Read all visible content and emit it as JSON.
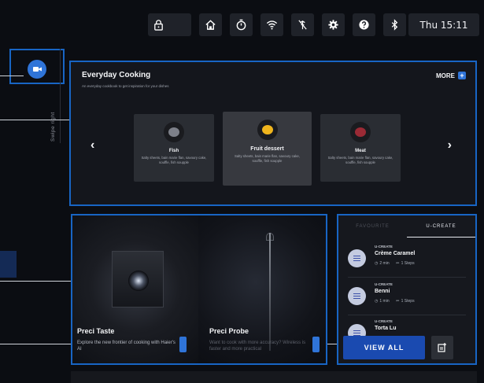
{
  "status_bar": {
    "icons": [
      "lock-icon",
      "home-icon",
      "timer-icon",
      "wifi-icon",
      "no-connection-icon",
      "settings-icon",
      "help-icon",
      "bluetooth-icon"
    ],
    "clock": "Thu 15:11"
  },
  "side": {
    "swipe_label": "Swipe right"
  },
  "everyday_cooking": {
    "title": "Everyday Cooking",
    "subtitle": "An everyday cookbook to get inspiration for your dishes",
    "more_label": "MORE",
    "more_icon": "+",
    "prev_icon": "‹",
    "next_icon": "›",
    "cards": [
      {
        "name": "Fish",
        "desc": "Salty sheets, bain marie flan, savoury cake, souffle, fish soupple",
        "dish_color": "#7d8089",
        "selected": false
      },
      {
        "name": "Fruit dessert",
        "desc": "Salty sheets, bain marie flan, savoury cake, souffle, fish soupple",
        "dish_color": "#f0b51d",
        "selected": true
      },
      {
        "name": "Meat",
        "desc": "Salty sheets, bain marie flan, savoury cake, souffle, fish soupple",
        "dish_color": "#9b2a35",
        "selected": false
      }
    ]
  },
  "preci": [
    {
      "title": "Preci Taste",
      "desc": "Explore the new frontier of cooking with Haier's AI"
    },
    {
      "title": "Preci Probe",
      "desc": "Want to cook with more accuracy? Wireless is faster and more practical"
    }
  ],
  "recipes": {
    "tabs": [
      "FAVOURITE",
      "U-CREATE"
    ],
    "active_tab": "U-CREATE",
    "items": [
      {
        "tag": "U-CREATE",
        "name": "Crème Caramel",
        "time": "2 min",
        "steps": "1 Steps"
      },
      {
        "tag": "U-CREATE",
        "name": "Benni",
        "time": "1 min",
        "steps": "1 Steps"
      },
      {
        "tag": "U-CREATE",
        "name": "Torta Lu",
        "time": "",
        "steps": ""
      }
    ],
    "view_all_label": "VIEW ALL",
    "add_icon": "add-recipe-icon"
  },
  "colors": {
    "accent": "#2f74d8",
    "highlight_border": "#1865c4",
    "button_primary": "#1a4ab0"
  }
}
